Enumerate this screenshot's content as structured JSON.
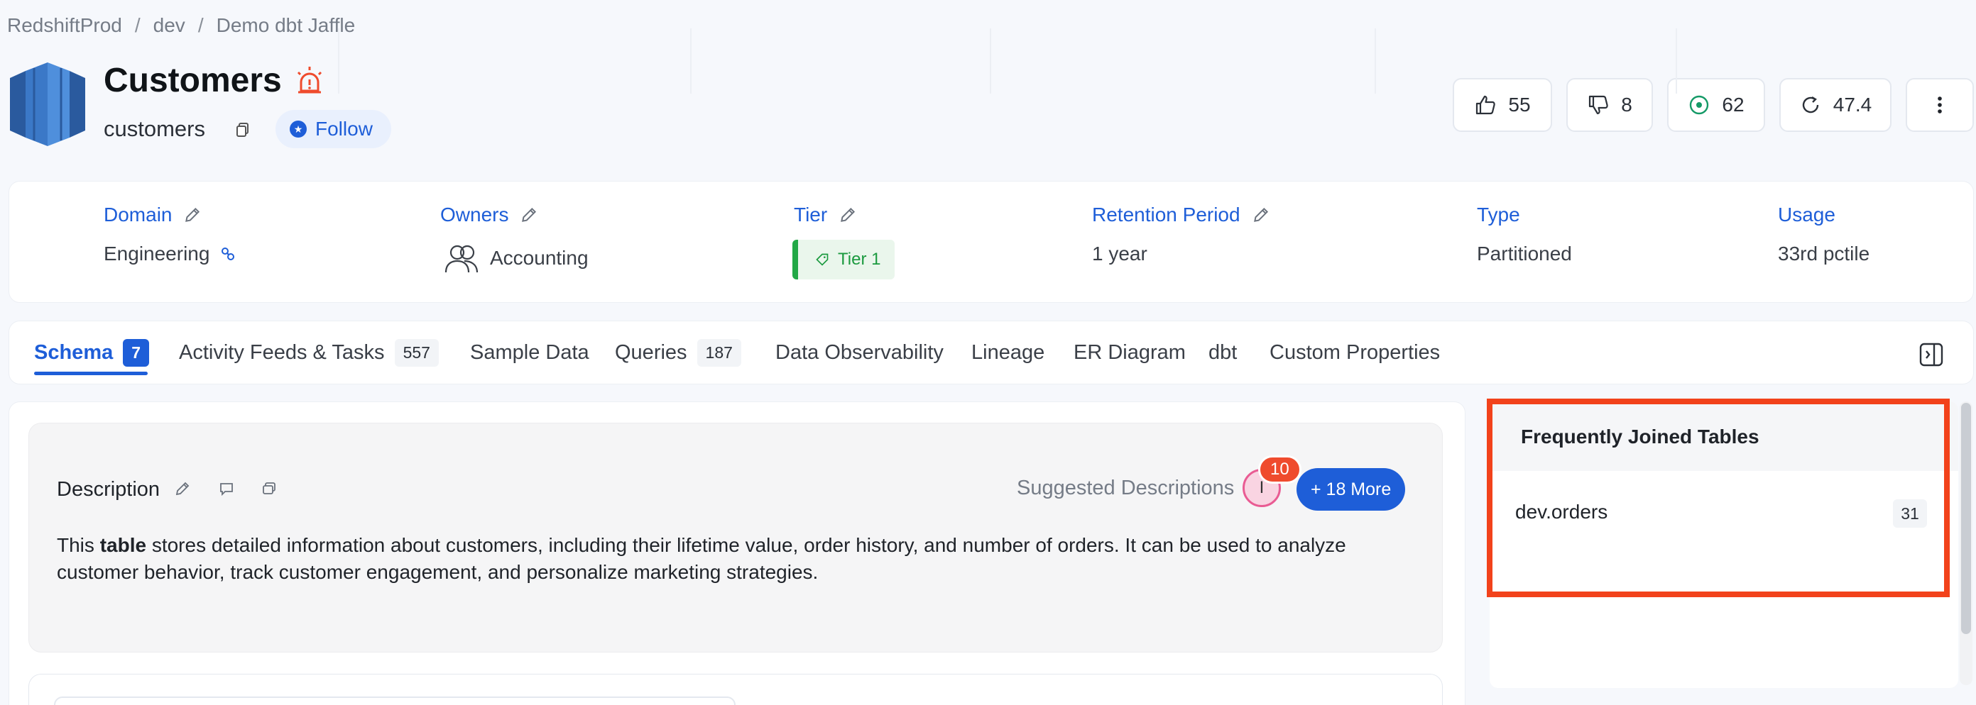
{
  "breadcrumb": [
    "RedshiftProd",
    "dev",
    "Demo dbt Jaffle"
  ],
  "header": {
    "title": "Customers",
    "fqn": "customers",
    "follow_label": "Follow"
  },
  "stats": {
    "likes": "55",
    "dislikes": "8",
    "views": "62",
    "version": "47.4"
  },
  "info": {
    "domain_label": "Domain",
    "domain_value": "Engineering",
    "owners_label": "Owners",
    "owners_value": "Accounting",
    "tier_label": "Tier",
    "tier_value": "Tier 1",
    "retention_label": "Retention Period",
    "retention_value": "1 year",
    "type_label": "Type",
    "type_value": "Partitioned",
    "usage_label": "Usage",
    "usage_value": "33rd pctile"
  },
  "tabs": [
    {
      "label": "Schema",
      "count": "7"
    },
    {
      "label": "Activity Feeds & Tasks",
      "count": "557"
    },
    {
      "label": "Sample Data",
      "count": null
    },
    {
      "label": "Queries",
      "count": "187"
    },
    {
      "label": "Data Observability",
      "count": null
    },
    {
      "label": "Lineage",
      "count": null
    },
    {
      "label": "ER Diagram",
      "count": null
    },
    {
      "label": "dbt",
      "count": null
    },
    {
      "label": "Custom Properties",
      "count": null
    }
  ],
  "description": {
    "title": "Description",
    "suggested_label": "Suggested Descriptions",
    "avatar_initial": "I",
    "suggested_count": "10",
    "more_label": "+ 18 More",
    "text_before": "This ",
    "text_bold": "table",
    "text_after": " stores detailed information about customers, including their lifetime value, order history, and number of orders. It can be used to analyze customer behavior, track customer engagement, and personalize marketing strategies."
  },
  "frequently_joined": {
    "title": "Frequently Joined Tables",
    "rows": [
      {
        "name": "dev.orders",
        "count": "31"
      }
    ]
  },
  "colors": {
    "accent": "#1e5ed8",
    "highlight": "#f2421b",
    "tier_green": "#22a846",
    "alert": "#ef4b2d"
  },
  "icons": [
    "redshift-logo-icon",
    "alert-siren-icon",
    "copy-icon",
    "star-icon",
    "thumbs-up-icon",
    "thumbs-down-icon",
    "eye-icon",
    "version-history-icon",
    "more-vertical-icon",
    "edit-icon",
    "link-icon",
    "team-icon",
    "tag-icon",
    "comment-icon",
    "request-icon",
    "panel-toggle-icon"
  ]
}
